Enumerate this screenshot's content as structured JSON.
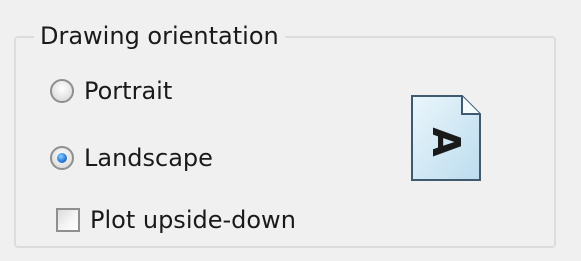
{
  "group": {
    "title": "Drawing orientation"
  },
  "options": {
    "portrait": {
      "label": "Portrait",
      "selected": false
    },
    "landscape": {
      "label": "Landscape",
      "selected": true
    },
    "upside_down": {
      "label": "Plot upside-down",
      "checked": false
    }
  },
  "preview": {
    "icon": "landscape-page-icon",
    "glyph": "A",
    "colors": {
      "page_fill": "#d7ecf7",
      "page_border": "#3f5a6e",
      "glyph": "#1a1a1a"
    }
  }
}
